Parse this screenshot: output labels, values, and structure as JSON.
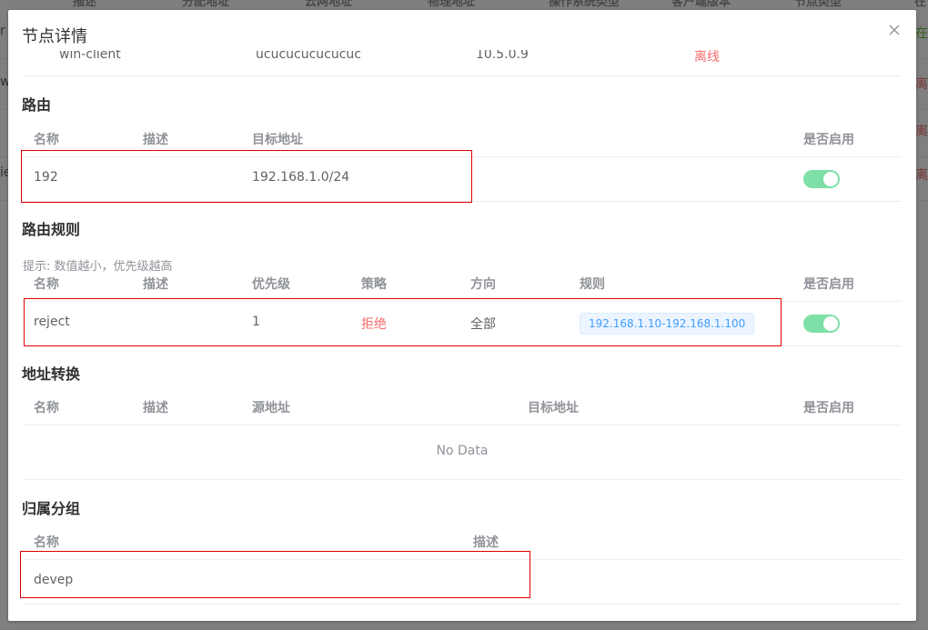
{
  "background": {
    "header": [
      "描述",
      "分配地址",
      "云网地址",
      "物理地址",
      "操作系统类型",
      "客户端版本",
      "节点类型",
      "在"
    ],
    "rows": [
      {
        "left": "r",
        "status": "在",
        "status_color": "#67c23a"
      },
      {
        "left": "w",
        "status": "离",
        "status_color": "#f56c6c"
      },
      {
        "left": "",
        "status": "离",
        "status_color": "#f56c6c"
      },
      {
        "left": "ie",
        "status": "离",
        "status_color": "#f56c6c"
      }
    ]
  },
  "dialog": {
    "title": "节点详情",
    "close_icon": "close-icon",
    "top_remnant": {
      "name": "win-client",
      "address": "ucucucucucucuc",
      "version": "10.5.0.9",
      "status": "离线"
    },
    "routes": {
      "title": "路由",
      "columns": [
        "名称",
        "描述",
        "目标地址",
        "是否启用"
      ],
      "rows": [
        {
          "name": "192",
          "description": "",
          "target": "192.168.1.0/24",
          "enabled": true
        }
      ]
    },
    "route_rules": {
      "title": "路由规则",
      "hint": "提示: 数值越小，优先级越高",
      "columns": [
        "名称",
        "描述",
        "优先级",
        "策略",
        "方向",
        "规则",
        "是否启用"
      ],
      "rows": [
        {
          "name": "reject",
          "description": "",
          "priority": "1",
          "strategy": "拒绝",
          "direction": "全部",
          "rule": "192.168.1.10-192.168.1.100",
          "enabled": true
        }
      ]
    },
    "nat": {
      "title": "地址转换",
      "columns": [
        "名称",
        "描述",
        "源地址",
        "目标地址",
        "是否启用"
      ],
      "empty_text": "No Data"
    },
    "groups": {
      "title": "归属分组",
      "columns": [
        "名称",
        "描述"
      ],
      "rows": [
        {
          "name": "devep",
          "description": ""
        }
      ]
    }
  },
  "colors": {
    "switch_on": "#7ee0a6",
    "danger": "#f56c6c",
    "tag_text": "#409eff",
    "highlight": "#e00000"
  }
}
